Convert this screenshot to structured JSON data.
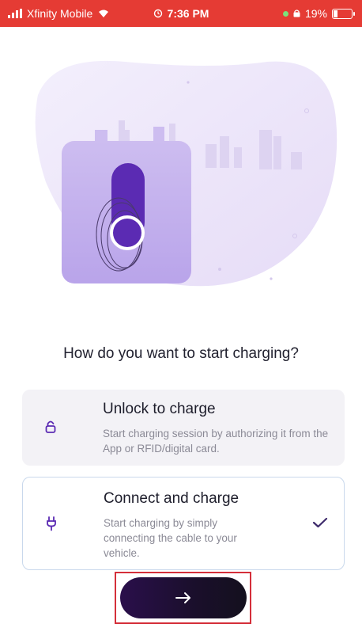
{
  "status_bar": {
    "carrier": "Xfinity Mobile",
    "time": "7:36 PM",
    "battery_percent": "19%",
    "battery_level": 0.19,
    "icons": [
      "signal-icon",
      "wifi-icon",
      "alarm-icon",
      "location-icon",
      "battery-icon"
    ]
  },
  "question": "How do you want to start charging?",
  "options": [
    {
      "title": "Unlock to charge",
      "description": "Start charging session by authorizing it from the App or RFID/digital card.",
      "icon": "lock-icon",
      "selected": false
    },
    {
      "title": "Connect and charge",
      "description": "Start charging by simply connecting the cable to your vehicle.",
      "icon": "plug-icon",
      "selected": true
    }
  ],
  "next_button": {
    "icon": "arrow-right-icon"
  },
  "colors": {
    "accent": "#5b2bb3",
    "status_bar": "#e53b34",
    "button": "#1e0f36",
    "selected_border": "#c9d8ec",
    "highlight": "#d42f3a"
  }
}
